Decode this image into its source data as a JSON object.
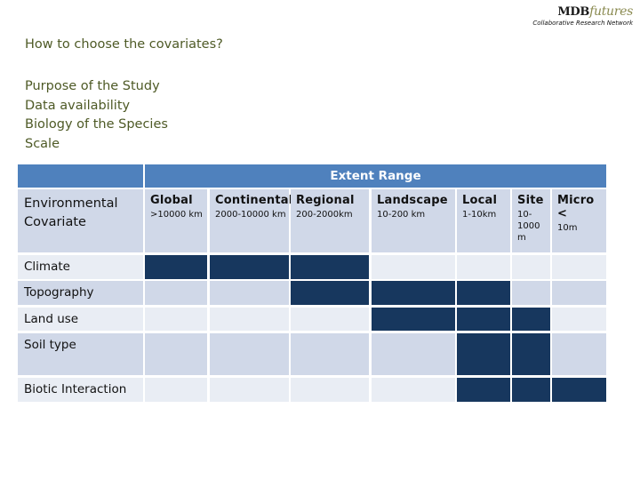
{
  "logo": {
    "main": "MDB",
    "italic": "futures",
    "subtitle": "Collaborative Research Network"
  },
  "title": "How to choose the covariates?",
  "bullets": [
    "Purpose of the Study",
    "Data availability",
    "Biology of the Species",
    "Scale"
  ],
  "table": {
    "header": "Extent Range",
    "row_header_label": "Environmental Covariate",
    "columns": [
      {
        "name": "Global",
        "range": ">10000 km"
      },
      {
        "name": "Continental",
        "range": "2000-10000 km"
      },
      {
        "name": "Regional",
        "range": "200-2000km"
      },
      {
        "name": "Landscape",
        "range": "10-200 km"
      },
      {
        "name": "Local",
        "range": "1-10km"
      },
      {
        "name": "Site",
        "range": "10-1000 m"
      },
      {
        "name": "Micro <",
        "range": "10m"
      }
    ],
    "rows": [
      {
        "label": "Climate",
        "active": [
          true,
          true,
          true,
          false,
          false,
          false,
          false
        ]
      },
      {
        "label": "Topography",
        "active": [
          false,
          false,
          true,
          true,
          true,
          false,
          false
        ]
      },
      {
        "label": "Land use",
        "active": [
          false,
          false,
          false,
          true,
          true,
          true,
          false
        ]
      },
      {
        "label": "Soil type",
        "active": [
          false,
          false,
          false,
          false,
          true,
          true,
          false
        ]
      },
      {
        "label": "Biotic Interaction",
        "active": [
          false,
          false,
          false,
          false,
          true,
          true,
          true
        ]
      }
    ],
    "colors": {
      "header": "#4f81bd",
      "active": "#17375e",
      "band_light": "#e9edf4",
      "band_dark": "#d0d8e8"
    }
  }
}
